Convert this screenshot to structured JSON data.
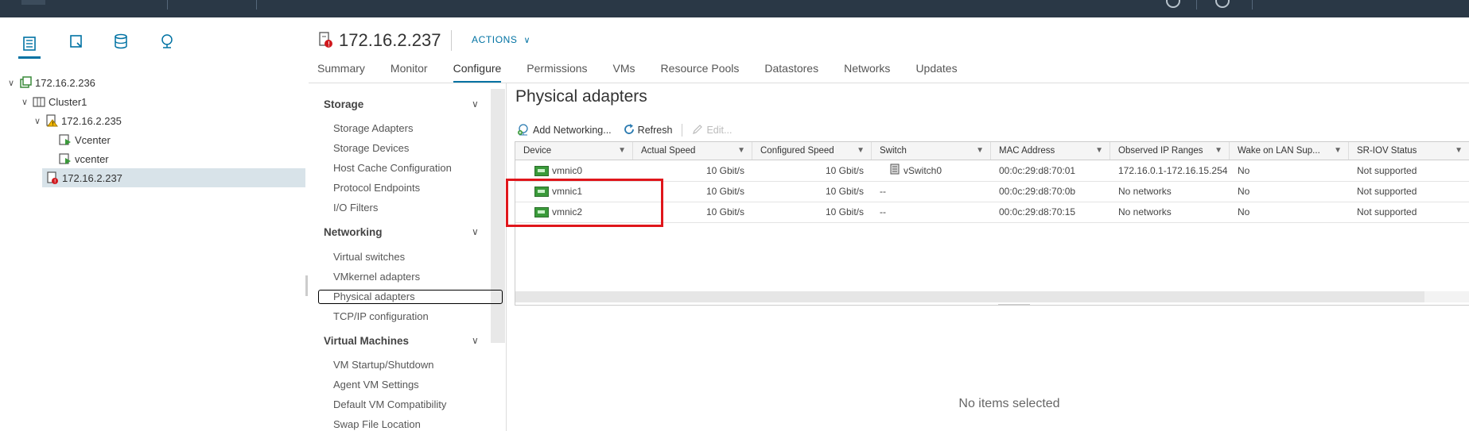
{
  "nav": {
    "tree": [
      {
        "label": "172.16.2.236",
        "icon": "datacenter-icon",
        "expanded": true
      },
      {
        "label": "Cluster1",
        "icon": "cluster-icon",
        "expanded": true
      },
      {
        "label": "172.16.2.235",
        "icon": "host-warning-icon",
        "expanded": true
      },
      {
        "label": "Vcenter",
        "icon": "vm-running-icon"
      },
      {
        "label": "vcenter",
        "icon": "vm-running-icon"
      },
      {
        "label": "172.16.2.237",
        "icon": "host-error-icon",
        "selected": true
      }
    ]
  },
  "header": {
    "title": "172.16.2.237",
    "actions_label": "ACTIONS"
  },
  "tabs": [
    "Summary",
    "Monitor",
    "Configure",
    "Permissions",
    "VMs",
    "Resource Pools",
    "Datastores",
    "Networks",
    "Updates"
  ],
  "active_tab": "Configure",
  "configure_menu": {
    "storage": {
      "title": "Storage",
      "items": [
        "Storage Adapters",
        "Storage Devices",
        "Host Cache Configuration",
        "Protocol Endpoints",
        "I/O Filters"
      ]
    },
    "networking": {
      "title": "Networking",
      "items": [
        "Virtual switches",
        "VMkernel adapters",
        "Physical adapters",
        "TCP/IP configuration"
      ]
    },
    "virtual_machines": {
      "title": "Virtual Machines",
      "items": [
        "VM Startup/Shutdown",
        "Agent VM Settings",
        "Default VM Compatibility",
        "Swap File Location"
      ]
    },
    "selected": "Physical adapters"
  },
  "panel": {
    "title": "Physical adapters",
    "toolbar": {
      "add_networking": "Add Networking...",
      "refresh": "Refresh",
      "edit": "Edit..."
    },
    "columns": [
      "Device",
      "Actual Speed",
      "Configured Speed",
      "Switch",
      "MAC Address",
      "Observed IP Ranges",
      "Wake on LAN Sup...",
      "SR-IOV Status"
    ],
    "rows": [
      [
        "vmnic0",
        "10 Gbit/s",
        "10 Gbit/s",
        "vSwitch0",
        "00:0c:29:d8:70:01",
        "172.16.0.1-172.16.15.254",
        "No",
        "Not supported"
      ],
      [
        "vmnic1",
        "10 Gbit/s",
        "10 Gbit/s",
        "--",
        "00:0c:29:d8:70:0b",
        "No networks",
        "No",
        "Not supported"
      ],
      [
        "vmnic2",
        "10 Gbit/s",
        "10 Gbit/s",
        "--",
        "00:0c:29:d8:70:15",
        "No networks",
        "No",
        "Not supported"
      ]
    ],
    "empty_detail": "No items selected"
  },
  "colors": {
    "topbar": "#2a3846",
    "accent": "#0072a3",
    "highlight_box": "#e0161b",
    "selected_row": "#d8e3e9"
  }
}
